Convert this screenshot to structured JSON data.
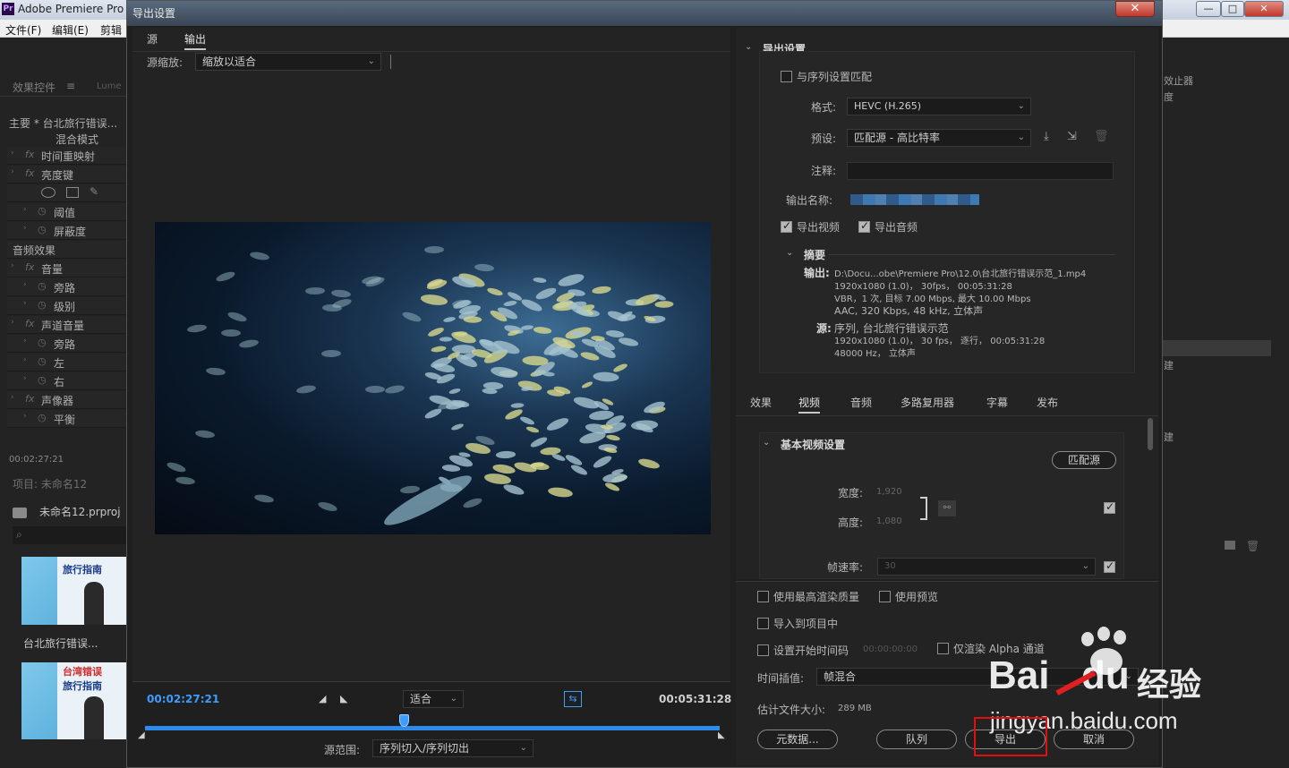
{
  "app": {
    "title": "Adobe Premiere Pro",
    "menu": [
      "文件(F)",
      "编辑(E)",
      "剪辑"
    ],
    "window_controls": [
      "—",
      "□",
      "✕"
    ]
  },
  "left_panel": {
    "tabs": [
      "效果控件",
      "Lume"
    ],
    "clip_header": "主要 * 台北旅行错误...",
    "blend_mode": "混合模式",
    "rows": [
      {
        "label": "时间重映射",
        "fx": true
      },
      {
        "label": "亮度键",
        "fx": true
      },
      {
        "label": "阈值",
        "fx": false
      },
      {
        "label": "屏蔽度",
        "fx": false
      },
      {
        "label": "音频效果",
        "fx": false,
        "section": true
      },
      {
        "label": "音量",
        "fx": true
      },
      {
        "label": "旁路",
        "fx": false
      },
      {
        "label": "级别",
        "fx": false
      },
      {
        "label": "声道音量",
        "fx": true
      },
      {
        "label": "旁路",
        "fx": false
      },
      {
        "label": "左",
        "fx": false
      },
      {
        "label": "右",
        "fx": false
      },
      {
        "label": "声像器",
        "fx": true
      },
      {
        "label": "平衡",
        "fx": false
      }
    ],
    "timecode": "00:02:27:21",
    "project_label": "项目: 未命名12",
    "project_file": "未命名12.prproj",
    "thumb1_caption": "台北旅行错误...",
    "thumb_text_1a": "台湾错误",
    "thumb_text_1b": "旅行指南"
  },
  "right_panel": {
    "fragments": [
      "效止器",
      "度",
      "建",
      "建"
    ]
  },
  "dialog": {
    "title": "导出设置",
    "close": "✕",
    "tabs": {
      "source": "源",
      "output": "输出"
    },
    "source_scale_label": "源缩放:",
    "source_scale_value": "缩放以适合",
    "timeline": {
      "current_time": "00:02:27:21",
      "fit_value": "适合",
      "end_time": "00:05:31:28",
      "source_range_label": "源范围:",
      "source_range_value": "序列切入/序列切出",
      "playhead_fraction": 0.45
    },
    "export_settings": {
      "heading": "导出设置",
      "match_sequence": "与序列设置匹配",
      "format_label": "格式:",
      "format_value": "HEVC (H.265)",
      "preset_label": "预设:",
      "preset_value": "匹配源 - 高比特率",
      "comment_label": "注释:",
      "output_name_label": "输出名称:",
      "export_video": "导出视频",
      "export_audio": "导出音频",
      "summary_heading": "摘要",
      "output_label": "输出:",
      "output_lines": [
        "D:\\Docu...obe\\Premiere Pro\\12.0\\台北旅行错误示范_1.mp4",
        "1920x1080 (1.0)， 30fps， 00:05:31:28",
        "VBR，1 次, 目标 7.00 Mbps, 最大 10.00 Mbps",
        "AAC, 320 Kbps, 48  kHz, 立体声"
      ],
      "source_label": "源:",
      "source_lines": [
        "序列, 台北旅行错误示范",
        "1920x1080 (1.0)， 30 fps， 逐行， 00:05:31:28",
        "48000 Hz， 立体声"
      ]
    },
    "settings_tabs": [
      "效果",
      "视频",
      "音频",
      "多路复用器",
      "字幕",
      "发布"
    ],
    "active_settings_tab": "视频",
    "video": {
      "heading": "基本视频设置",
      "match_source": "匹配源",
      "width_label": "宽度:",
      "width_value": "1,920",
      "height_label": "高度:",
      "height_value": "1,080",
      "framerate_label": "帧速率:",
      "framerate_value": "30"
    },
    "bottom": {
      "max_render": "使用最高渲染质量",
      "use_previews": "使用预览",
      "import_project": "导入到项目中",
      "set_start_tc": "设置开始时间码",
      "start_tc_value": "00:00:00:00",
      "render_alpha": "仅渲染 Alpha 通道",
      "interp_label": "时间插值:",
      "interp_value": "帧混合",
      "file_size_label": "估计文件大小:",
      "file_size_value": "289 MB",
      "metadata_button": "元数据...",
      "queue_button": "队列",
      "export_button": "导出",
      "cancel_button": "取消"
    }
  },
  "watermark": {
    "brand_a": "Bai",
    "brand_b": "du",
    "brand_c": "经验",
    "url": "jingyan.baidu.com"
  },
  "colors": {
    "accent_blue": "#2d8ceb",
    "timecode_blue": "#3c9cff",
    "highlight_red": "#e01010"
  }
}
